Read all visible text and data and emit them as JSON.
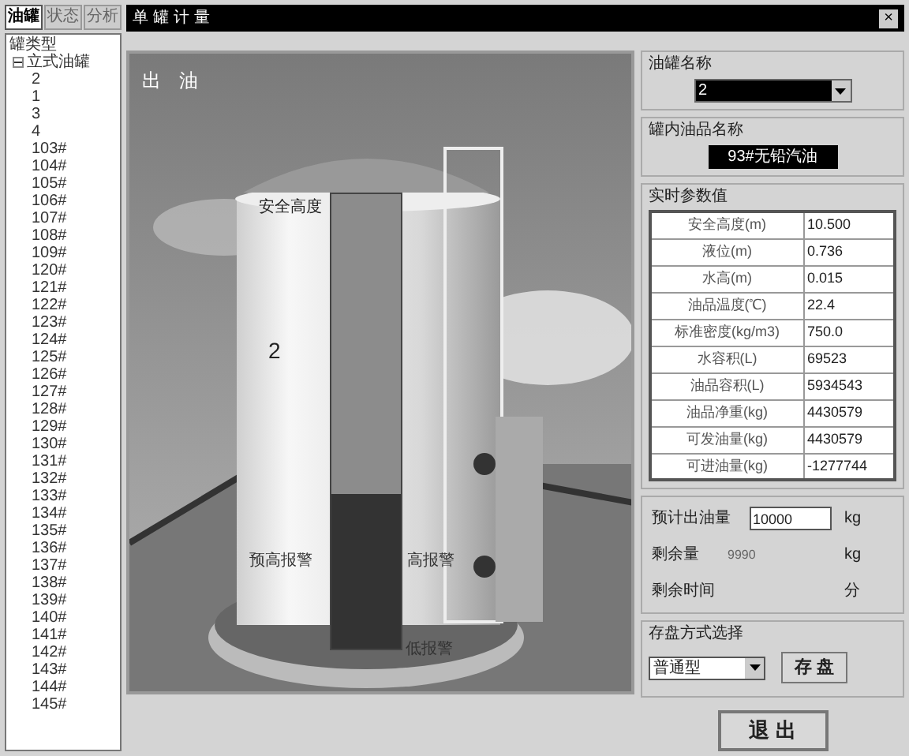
{
  "tabs": [
    {
      "label": "油罐",
      "selected": true
    },
    {
      "label": "状态",
      "selected": false
    },
    {
      "label": "分析",
      "selected": false
    }
  ],
  "window": {
    "title": "单罐计量",
    "close": "×"
  },
  "tree": {
    "label": "罐类型",
    "children": [
      {
        "label": "立式油罐",
        "expanded": true,
        "children": [
          {
            "label": "2"
          },
          {
            "label": "1"
          },
          {
            "label": "3"
          },
          {
            "label": "4"
          },
          {
            "label": "103#"
          },
          {
            "label": "104#"
          },
          {
            "label": "105#"
          },
          {
            "label": "106#"
          },
          {
            "label": "107#"
          },
          {
            "label": "108#"
          },
          {
            "label": "109#"
          },
          {
            "label": "120#"
          },
          {
            "label": "121#"
          },
          {
            "label": "122#"
          },
          {
            "label": "123#"
          },
          {
            "label": "124#"
          },
          {
            "label": "125#"
          },
          {
            "label": "126#"
          },
          {
            "label": "127#"
          },
          {
            "label": "128#"
          },
          {
            "label": "129#"
          },
          {
            "label": "130#"
          },
          {
            "label": "131#"
          },
          {
            "label": "132#"
          },
          {
            "label": "133#"
          },
          {
            "label": "134#"
          },
          {
            "label": "135#"
          },
          {
            "label": "136#"
          },
          {
            "label": "137#"
          },
          {
            "label": "138#"
          },
          {
            "label": "139#"
          },
          {
            "label": "140#"
          },
          {
            "label": "141#"
          },
          {
            "label": "142#"
          },
          {
            "label": "143#"
          },
          {
            "label": "144#"
          },
          {
            "label": "145#"
          }
        ]
      }
    ]
  },
  "scene": {
    "mode": "出 油",
    "tank_number": "2",
    "safe_height_label": "安全高度",
    "pre_alarm_label": "预高报警",
    "high_alarm_label": "高报警",
    "low_alarm_label": "低报警",
    "gauge": {
      "level": 0.34
    }
  },
  "tank_name": {
    "label": "油罐名称",
    "value": "2"
  },
  "oil_name": {
    "label": "罐内油品名称",
    "value": "93#无铅汽油"
  },
  "params": {
    "label": "实时参数值",
    "rows": [
      {
        "name": "安全高度(m)",
        "value": "10.500"
      },
      {
        "name": "液位(m)",
        "value": "0.736"
      },
      {
        "name": "水高(m)",
        "value": "0.015"
      },
      {
        "name": "油品温度(℃)",
        "value": "22.4"
      },
      {
        "name": "标准密度(kg/m3)",
        "value": "750.0"
      },
      {
        "name": "水容积(L)",
        "value": "69523"
      },
      {
        "name": "油品容积(L)",
        "value": "5934543"
      },
      {
        "name": "油品净重(kg)",
        "value": "4430579"
      },
      {
        "name": "可发油量(kg)",
        "value": "4430579"
      },
      {
        "name": "可进油量(kg)",
        "value": "-1277744"
      }
    ]
  },
  "outflow": {
    "label": "预计出油量",
    "value": "10000",
    "unit": "kg"
  },
  "remaining": {
    "label": "剩余量",
    "value": "9990",
    "unit": "kg"
  },
  "remaining_time": {
    "label": "剩余时间",
    "unit": "分"
  },
  "save_mode": {
    "label": "存盘方式选择",
    "value": "普通型",
    "button": "存 盘"
  },
  "exit_button": "退 出"
}
